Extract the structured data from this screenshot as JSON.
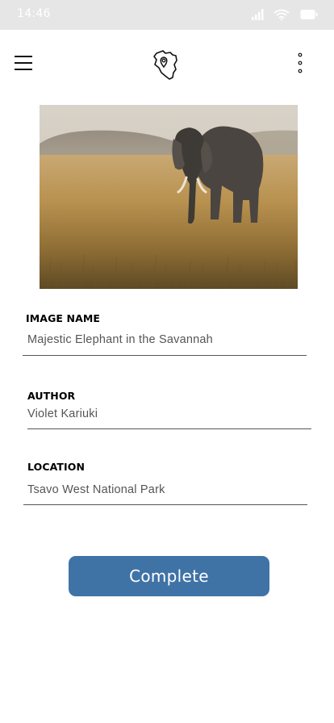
{
  "status_bar": {
    "time": "14:46",
    "icons": [
      "signal-icon",
      "wifi-icon",
      "battery-icon"
    ]
  },
  "header": {
    "menu_icon": "hamburger-menu-icon",
    "logo_icon": "kenya-map-pin-icon",
    "more_icon": "more-vertical-icon"
  },
  "image": {
    "subject": "elephant-savannah-photo"
  },
  "fields": [
    {
      "label": "IMAGE NAME",
      "value": "Majestic Elephant in the Savannah"
    },
    {
      "label": "AUTHOR",
      "value": "Violet Kariuki"
    },
    {
      "label": "LOCATION",
      "value": "Tsavo West National Park"
    }
  ],
  "actions": {
    "complete_label": "Complete"
  },
  "colors": {
    "status_bar_bg": "#e6e6e6",
    "button_bg": "#3f73a6",
    "button_text": "#ffffff"
  }
}
